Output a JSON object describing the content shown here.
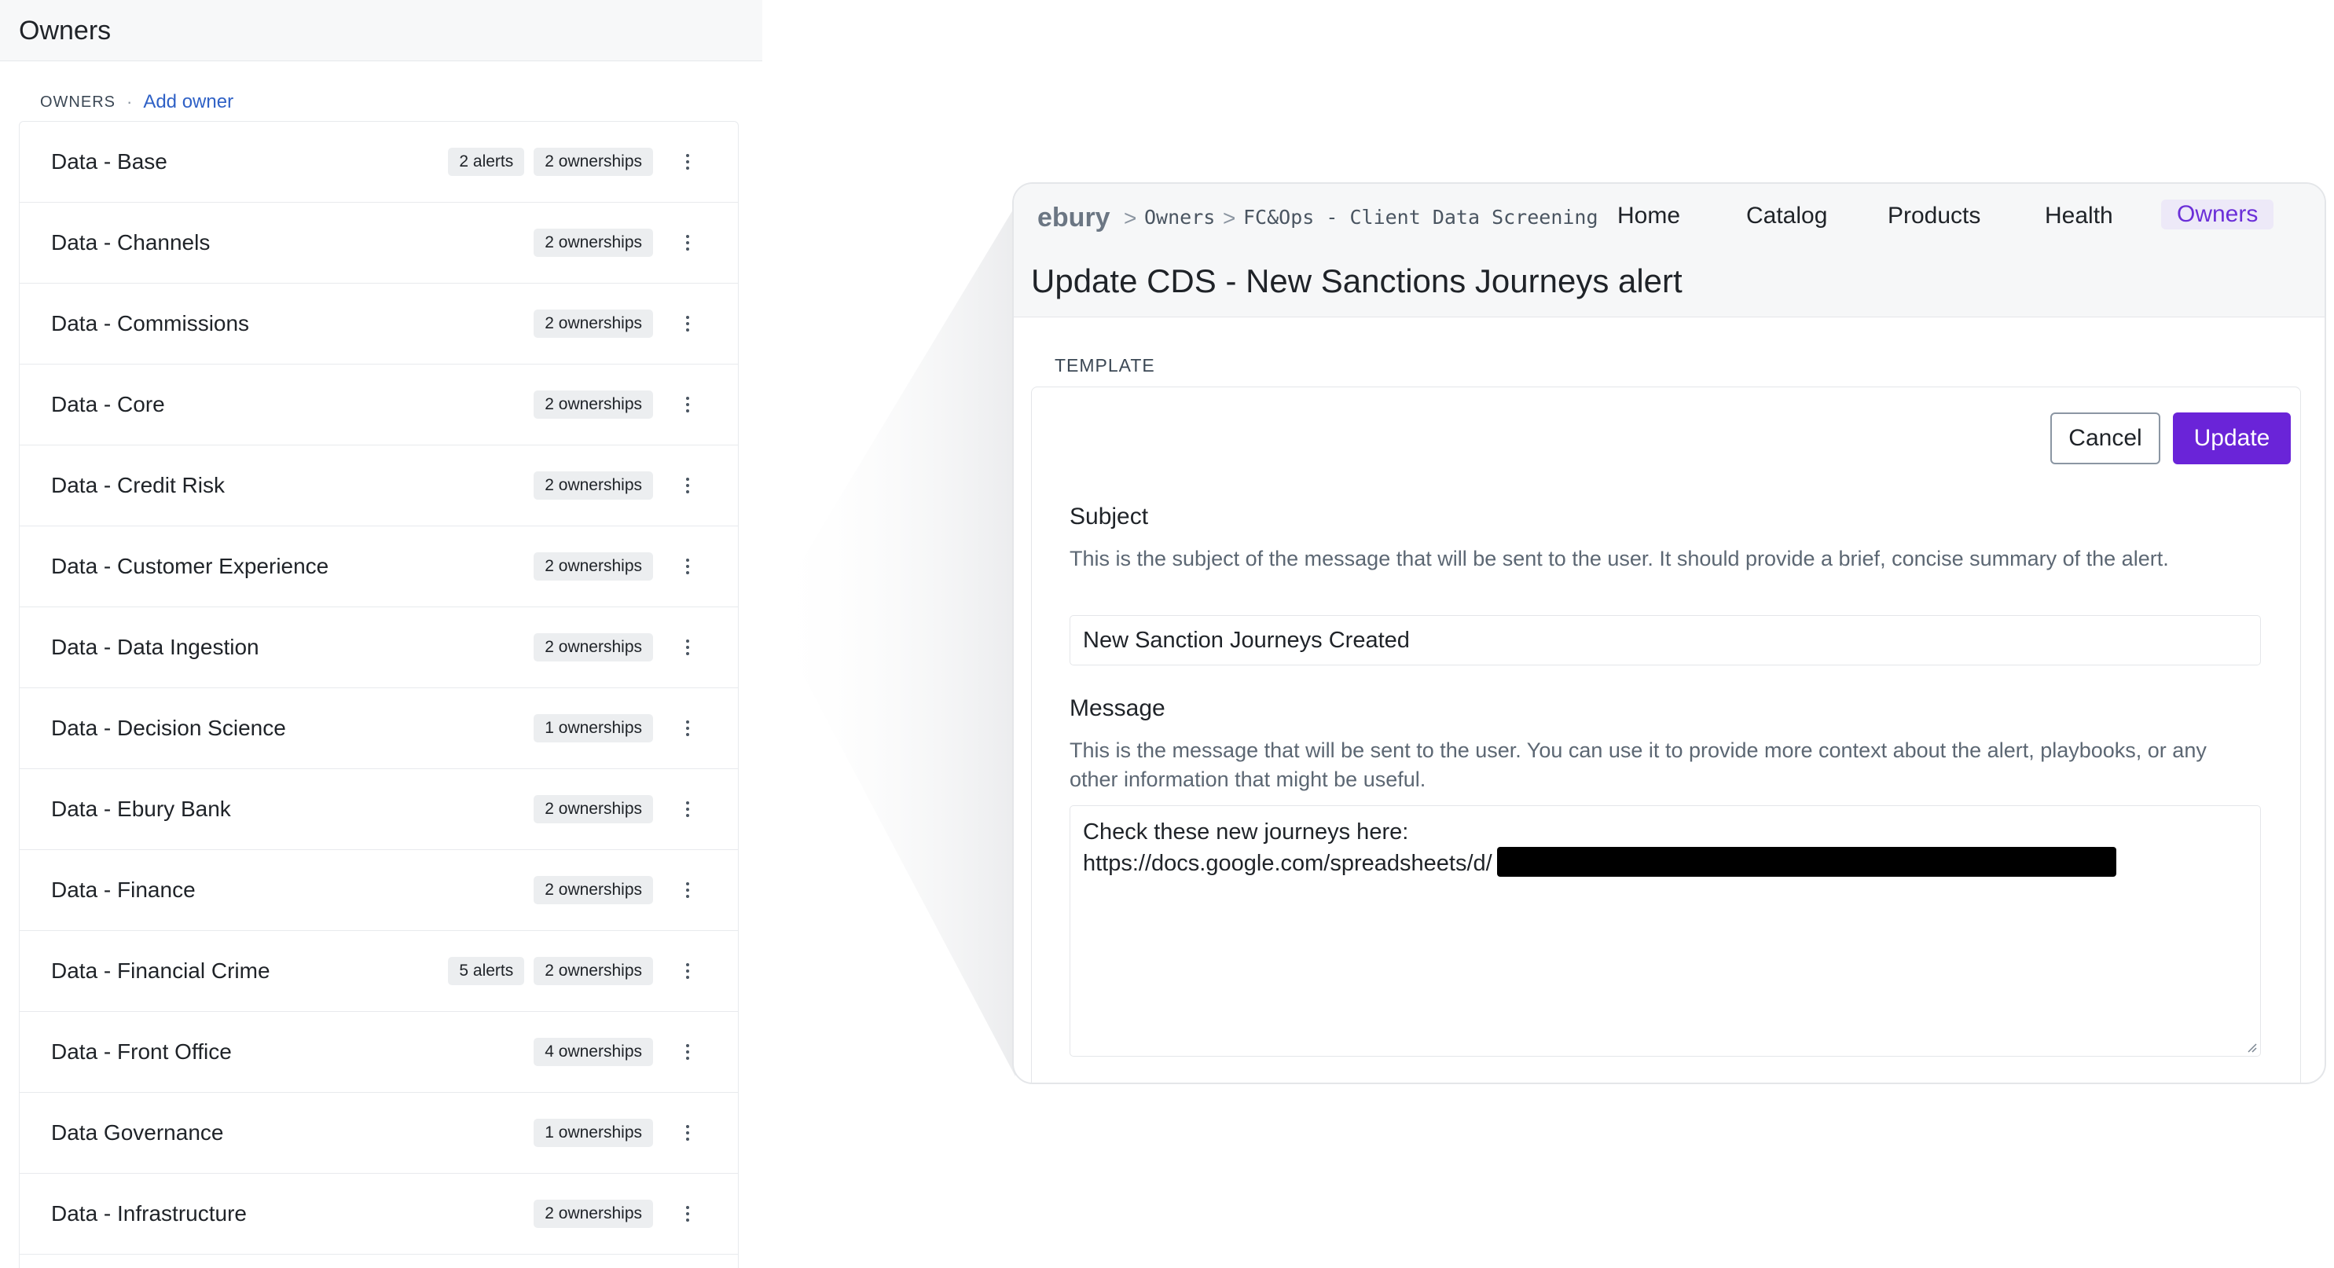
{
  "left": {
    "title": "Owners",
    "caption": "OWNERS",
    "separator": "·",
    "add_owner": "Add owner",
    "owners": [
      {
        "name": "Data - Base",
        "alerts": "2 alerts",
        "ownerships": "2 ownerships"
      },
      {
        "name": "Data - Channels",
        "alerts": "",
        "ownerships": "2 ownerships"
      },
      {
        "name": "Data - Commissions",
        "alerts": "",
        "ownerships": "2 ownerships"
      },
      {
        "name": "Data - Core",
        "alerts": "",
        "ownerships": "2 ownerships"
      },
      {
        "name": "Data - Credit Risk",
        "alerts": "",
        "ownerships": "2 ownerships"
      },
      {
        "name": "Data - Customer Experience",
        "alerts": "",
        "ownerships": "2 ownerships"
      },
      {
        "name": "Data - Data Ingestion",
        "alerts": "",
        "ownerships": "2 ownerships"
      },
      {
        "name": "Data - Decision Science",
        "alerts": "",
        "ownerships": "1 ownerships"
      },
      {
        "name": "Data - Ebury Bank",
        "alerts": "",
        "ownerships": "2 ownerships"
      },
      {
        "name": "Data - Finance",
        "alerts": "",
        "ownerships": "2 ownerships"
      },
      {
        "name": "Data - Financial Crime",
        "alerts": "5 alerts",
        "ownerships": "2 ownerships"
      },
      {
        "name": "Data - Front Office",
        "alerts": "",
        "ownerships": "4 ownerships"
      },
      {
        "name": "Data Governance",
        "alerts": "",
        "ownerships": "1 ownerships"
      },
      {
        "name": "Data - Infrastructure",
        "alerts": "",
        "ownerships": "2 ownerships"
      }
    ]
  },
  "detail": {
    "brand": "ebury",
    "breadcrumb": [
      "Owners",
      "FC&Ops - Client Data Screening"
    ],
    "breadcrumb_separator": ">",
    "nav": [
      "Home",
      "Catalog",
      "Products",
      "Health",
      "Owners"
    ],
    "active_nav": "Owners",
    "title": "Update CDS - New Sanctions Journeys alert",
    "section": "TEMPLATE",
    "cancel_label": "Cancel",
    "update_label": "Update",
    "subject": {
      "label": "Subject",
      "help": "This is the subject of the message that will be sent to the user. It should provide a brief, concise summary of the alert.",
      "value": "New Sanction Journeys Created"
    },
    "message": {
      "label": "Message",
      "help": "This is the message that will be sent to the user. You can use it to provide more context about the alert, playbooks, or any other information that might be useful.",
      "line1": "Check these new journeys here:",
      "line2": "https://docs.google.com/spreadsheets/d/"
    }
  },
  "colors": {
    "accent": "#6a24d8",
    "active_nav": "#6b2fd8",
    "link": "#2f61c6",
    "badge_bg": "#eceef0",
    "redaction": "#000000"
  }
}
